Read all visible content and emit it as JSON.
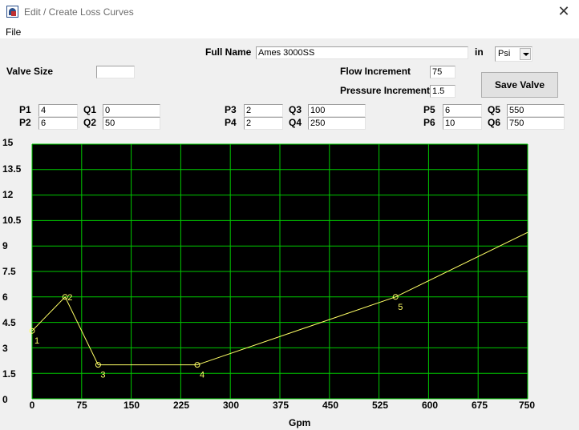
{
  "window": {
    "title": "Edit / Create Loss Curves",
    "close_glyph": "✕"
  },
  "menu": {
    "file": "File"
  },
  "form": {
    "full_name_label": "Full Name",
    "full_name_value": "Ames 3000SS",
    "in_label": "in",
    "unit_selected": "Psi",
    "valve_size_label": "Valve Size",
    "valve_size_value": "",
    "flow_increment_label": "Flow Increment",
    "flow_increment_value": "75",
    "pressure_increment_label": "Pressure Increment",
    "pressure_increment_value": "1.5",
    "save_button": "Save Valve",
    "points": [
      {
        "p_label": "P1",
        "p_value": "4",
        "q_label": "Q1",
        "q_value": "0"
      },
      {
        "p_label": "P2",
        "p_value": "6",
        "q_label": "Q2",
        "q_value": "50"
      },
      {
        "p_label": "P3",
        "p_value": "2",
        "q_label": "Q3",
        "q_value": "100"
      },
      {
        "p_label": "P4",
        "p_value": "2",
        "q_label": "Q4",
        "q_value": "250"
      },
      {
        "p_label": "P5",
        "p_value": "6",
        "q_label": "Q5",
        "q_value": "550"
      },
      {
        "p_label": "P6",
        "p_value": "10",
        "q_label": "Q6",
        "q_value": "750"
      }
    ]
  },
  "chart_data": {
    "type": "line",
    "xlabel": "Gpm",
    "ylabel": "",
    "xlim": [
      0,
      750
    ],
    "ylim": [
      0,
      15
    ],
    "x_ticks": [
      "0",
      "75",
      "150",
      "225",
      "300",
      "375",
      "450",
      "525",
      "600",
      "675",
      "750"
    ],
    "y_ticks": [
      "15",
      "13.5",
      "12",
      "10.5",
      "9",
      "7.5",
      "6",
      "4.5",
      "3",
      "1.5",
      "0"
    ],
    "grid": true,
    "background_color": "#000000",
    "grid_color": "#00c800",
    "line_color": "#ffff66",
    "series": [
      {
        "x": [
          0,
          50,
          100,
          250,
          550,
          750
        ],
        "y": [
          4,
          6,
          2,
          2,
          6,
          9.8
        ]
      }
    ],
    "point_labels": [
      "1",
      "2",
      "3",
      "4",
      "5"
    ]
  }
}
